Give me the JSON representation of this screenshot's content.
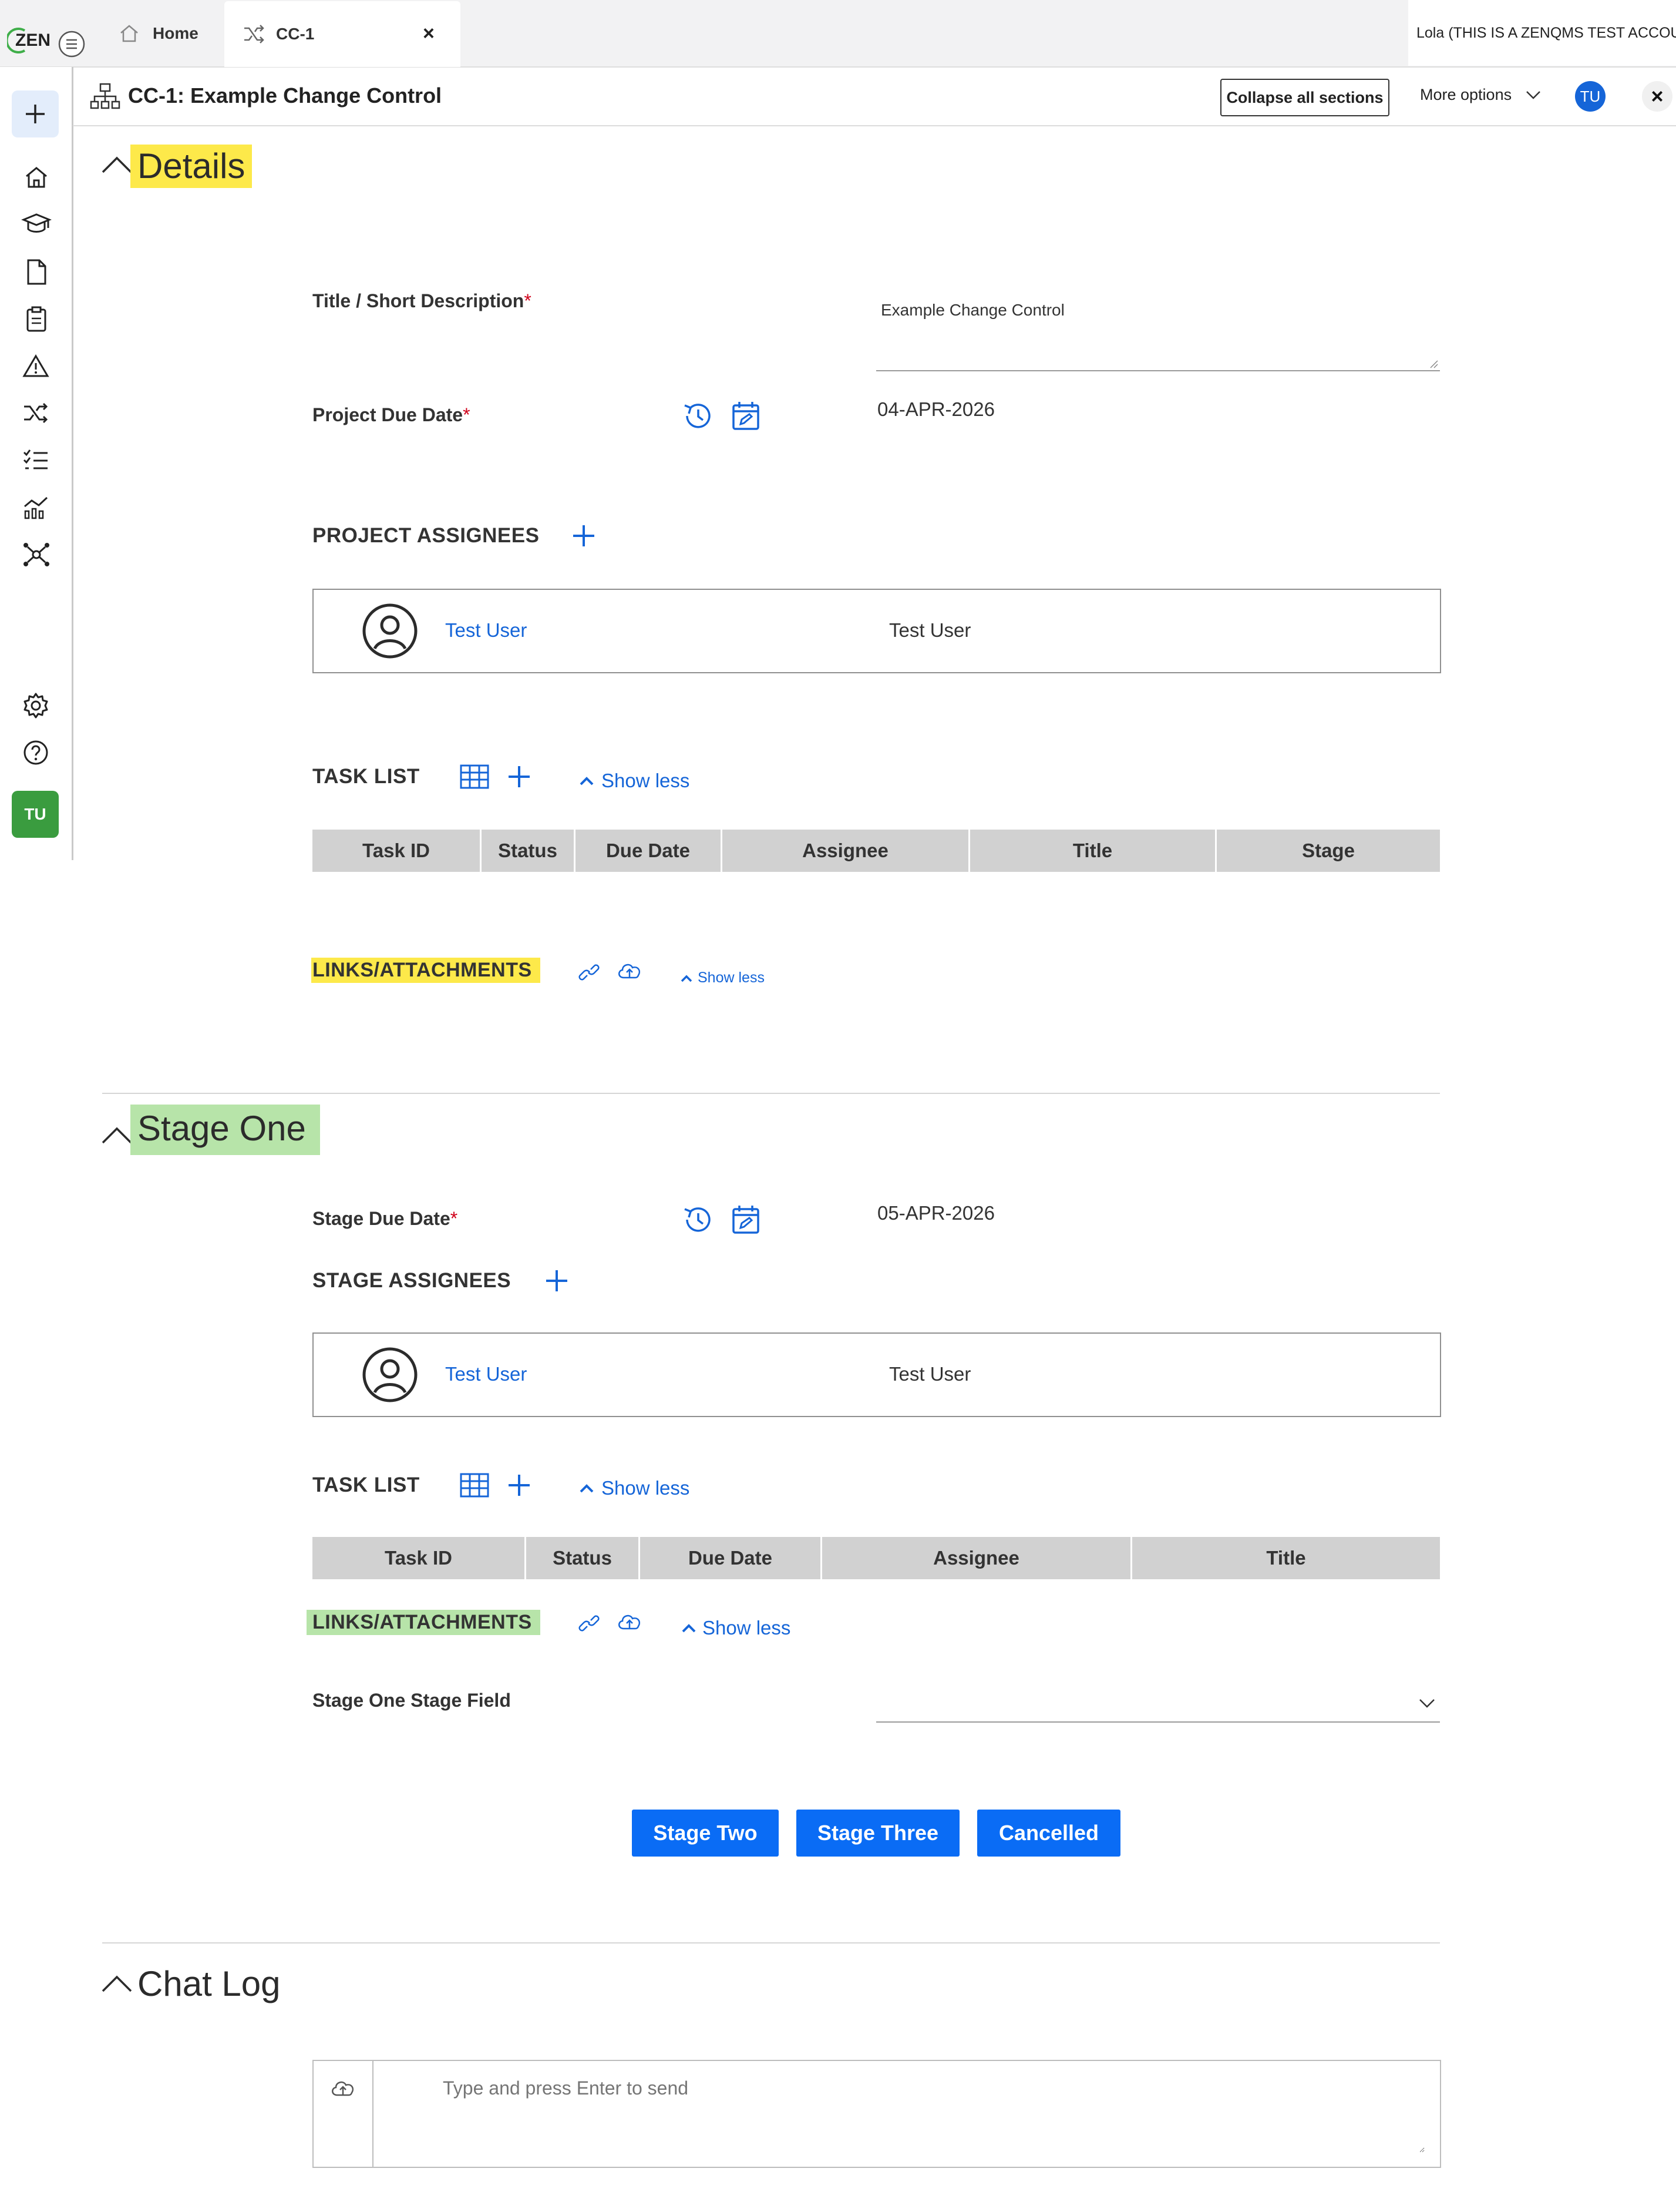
{
  "app": {
    "logo_text": "ZEN",
    "user_banner": "Lola (THIS IS A ZENQMS TEST ACCOUNT"
  },
  "tabs": [
    {
      "label": "Home",
      "icon": "home-icon"
    },
    {
      "label": "CC-1",
      "icon": "shuffle-icon",
      "close": "×"
    }
  ],
  "sidebar": {
    "items": [
      "add-icon",
      "home-icon",
      "training-icon",
      "document-icon",
      "audit-icon",
      "risk-icon",
      "change-control-icon",
      "checklist-icon",
      "analytics-icon",
      "network-icon"
    ],
    "bottom": [
      "settings-icon",
      "help-icon"
    ],
    "avatar": "TU"
  },
  "header": {
    "title": "CC-1: Example Change Control",
    "collapse_label": "Collapse all sections",
    "more_options": "More options",
    "avatar": "TU",
    "close": "×"
  },
  "details": {
    "title": "Details",
    "title_highlight": "#fde94a",
    "short_desc_label": "Title / Short Description",
    "short_desc_value": "Example Change Control",
    "due_label": "Project Due Date",
    "due_value": "04-APR-2026",
    "assignees_label": "PROJECT ASSIGNEES",
    "assignee_link": "Test User",
    "assignee_name": "Test User",
    "task_list_label": "TASK LIST",
    "show_less": "Show less",
    "task_columns": [
      "Task ID",
      "Status",
      "Due Date",
      "Assignee",
      "Title",
      "Stage"
    ],
    "links_label": "LINKS/ATTACHMENTS",
    "links_highlight": "#fde94a",
    "links_show_less": "Show less"
  },
  "stage_one": {
    "title": "Stage One",
    "title_highlight": "#b7e4a9",
    "due_label": "Stage Due Date",
    "due_value": "05-APR-2026",
    "assignees_label": "STAGE ASSIGNEES",
    "assignee_link": "Test User",
    "assignee_name": "Test User",
    "task_list_label": "TASK LIST",
    "show_less": "Show less",
    "task_columns": [
      "Task ID",
      "Status",
      "Due Date",
      "Assignee",
      "Title"
    ],
    "links_label": "LINKS/ATTACHMENTS",
    "links_highlight": "#b7e4a9",
    "links_show_less": "Show less",
    "stage_field_label": "Stage One Stage Field",
    "buttons": [
      "Stage Two",
      "Stage Three",
      "Cancelled"
    ]
  },
  "chat": {
    "title": "Chat Log",
    "placeholder": "Type and press Enter to send"
  },
  "colors": {
    "accent": "#1565d8",
    "primary_button": "#0a6cf5",
    "avatar_green": "#3a9c3f"
  }
}
